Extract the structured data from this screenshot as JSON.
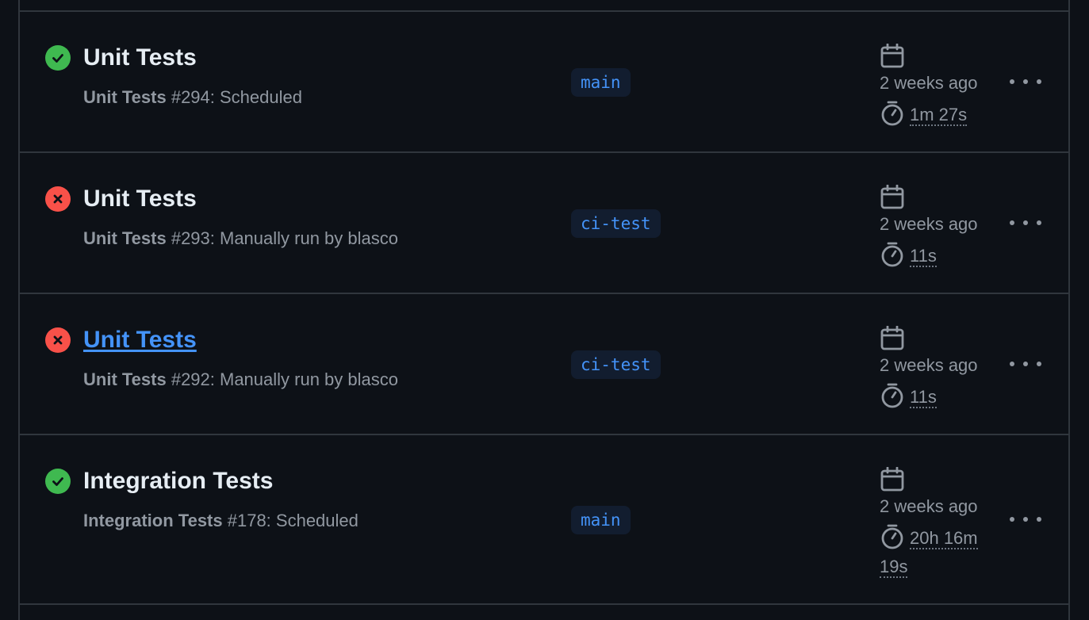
{
  "runs": [
    {
      "status": "success",
      "title": "Unit Tests",
      "workflow": "Unit Tests",
      "run_info": " #294: Scheduled",
      "branch": "main",
      "date": "2 weeks ago",
      "duration": "1m 27s"
    },
    {
      "status": "failure",
      "title": "Unit Tests",
      "workflow": "Unit Tests",
      "run_info": " #293: Manually run by blasco",
      "branch": "ci-test",
      "date": "2 weeks ago",
      "duration": "11s"
    },
    {
      "status": "failure",
      "title": "Unit Tests",
      "workflow": "Unit Tests",
      "run_info": " #292: Manually run by blasco",
      "branch": "ci-test",
      "date": "2 weeks ago",
      "duration": "11s"
    },
    {
      "status": "success",
      "title": "Integration Tests",
      "workflow": "Integration Tests",
      "run_info": " #178: Scheduled",
      "branch": "main",
      "date": "2 weeks ago",
      "duration_line1": "20h 16m",
      "duration_line2": "19s"
    }
  ],
  "icons": {
    "success": "check-circle-icon",
    "failure": "x-circle-icon",
    "date": "calendar-icon",
    "duration": "stopwatch-icon",
    "menu": "kebab-horizontal-icon"
  },
  "colors": {
    "background": "#0d1117",
    "border": "#30363d",
    "success": "#3fb950",
    "failure": "#f85149",
    "link": "#4493f8",
    "muted": "#9198a1"
  }
}
